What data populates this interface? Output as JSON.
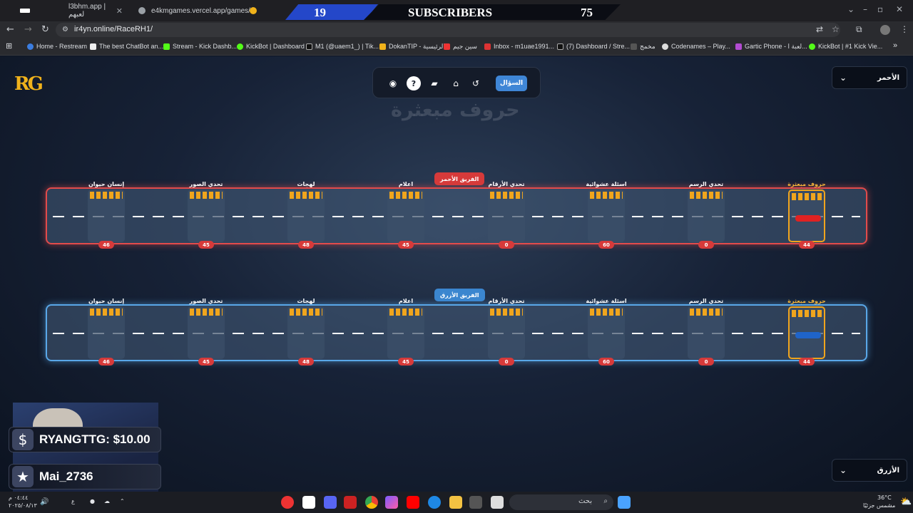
{
  "browser": {
    "tabs": [
      {
        "title": "l3bhm.app | لعبهم"
      },
      {
        "title": "e4kmgames.vercel.app/games/"
      }
    ],
    "url": "ir4yn.online/RaceRH1/",
    "bookmarks": [
      "Home - Restream",
      "The best ChatBot an...",
      "Stream - Kick Dashb...",
      "KickBot | Dashboard",
      "M1 (@uaem1_) | Tik...",
      "DokanTIP - الرئيسية",
      "سين جيم",
      "Inbox - m1uae1991...",
      "(7) Dashboard / Stre...",
      "مخمج",
      "Codenames – Play...",
      "Gartic Phone - لعبة ا...",
      "KickBot | #1 Kick Vie..."
    ]
  },
  "subscribers": {
    "left": "19",
    "label": "SUBSCRIBERS",
    "right": "75"
  },
  "game": {
    "logo": "RG",
    "question_button": "السؤال",
    "title_watermark": "حروف مبعثرة",
    "red_team_select": "الأحمر",
    "blue_team_select": "الأزرق",
    "red_team_tag": "الفريق الأحمر",
    "blue_team_tag": "الفريق الأزرق",
    "stations": [
      "إنسان حيوان",
      "تحدي الصور",
      "لهجات",
      "اعلام",
      "تحدي الأرقام",
      "اسئلة عشوائية",
      "تحدي الرسم",
      "حروف مبعثرة"
    ],
    "red_scores": [
      "46",
      "45",
      "48",
      "45",
      "0",
      "60",
      "0",
      "44"
    ],
    "blue_scores": [
      "46",
      "45",
      "48",
      "45",
      "0",
      "60",
      "0",
      "44"
    ],
    "colors": {
      "red": "#e24b4b",
      "blue": "#59a7e8",
      "accent": "#f0a51d"
    }
  },
  "overlay": {
    "donation": "RYANGTTG: $10.00",
    "follower": "Mai_2736"
  },
  "taskbar": {
    "search_placeholder": "بحث",
    "weather_temp": "36°C",
    "weather_desc": "مشمس جزئيًا",
    "time": "٠٤:٤٤ م",
    "date": "٢٠٢٥/٠٨/١٣",
    "lang": "ع"
  }
}
